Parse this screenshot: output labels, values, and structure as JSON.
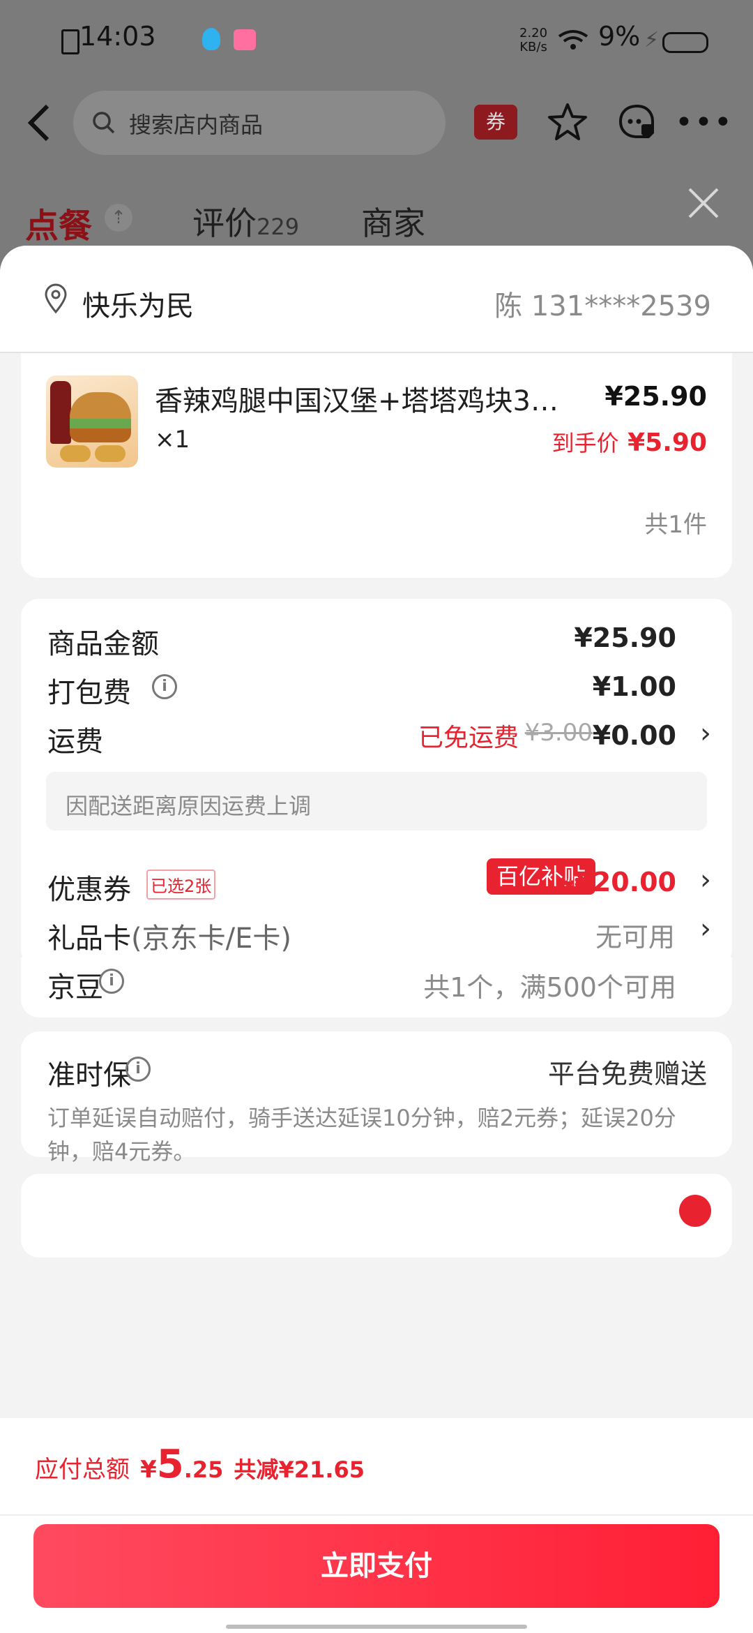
{
  "status_bar": {
    "time": "14:03",
    "net_speed_top": "2.20",
    "net_speed_unit": "KB/s",
    "battery": "9%"
  },
  "header": {
    "search_placeholder": "搜索店内商品",
    "coupon_label": "券"
  },
  "tabs": {
    "order": "点餐",
    "reviews": "评价",
    "reviews_count": "229",
    "merchant": "商家"
  },
  "address": {
    "name": "快乐为民",
    "contact": "陈  131****2539"
  },
  "item": {
    "title": "香辣鸡腿中国汉堡+塔塔鸡块3…",
    "qty": "×1",
    "price": "¥25.90",
    "final_label": "到手价",
    "final_price": "¥5.90",
    "count": "共1件"
  },
  "fees": {
    "goods_label": "商品金额",
    "goods_value": "¥25.90",
    "packing_label": "打包费",
    "packing_value": "¥1.00",
    "delivery_label": "运费",
    "delivery_free": "已免运费",
    "delivery_original": "¥3.00",
    "delivery_value": "¥0.00",
    "delivery_note": "因配送距离原因运费上调",
    "coupon_label": "优惠券",
    "coupon_selected": "已选2张",
    "coupon_tag": "百亿补贴",
    "coupon_value": "-¥20.00",
    "giftcard_label": "礼品卡",
    "giftcard_sub": "(京东卡/E卡)",
    "giftcard_value": "无可用",
    "beans_label": "京豆",
    "beans_value": "共1个，满500个可用"
  },
  "ontime": {
    "label": "准时保",
    "value": "平台免费赠送",
    "desc": "订单延误自动赔付，骑手送达延误10分钟，赔2元券；延误20分钟，赔4元券。"
  },
  "footer": {
    "total_label": "应付总额",
    "currency": "¥",
    "total_int": "5",
    "total_dec": ".25",
    "discount": "共减¥21.65",
    "pay_button": "立即支付"
  },
  "colors": {
    "accent": "#e8232f",
    "pay_button": "#ff2a3d"
  }
}
